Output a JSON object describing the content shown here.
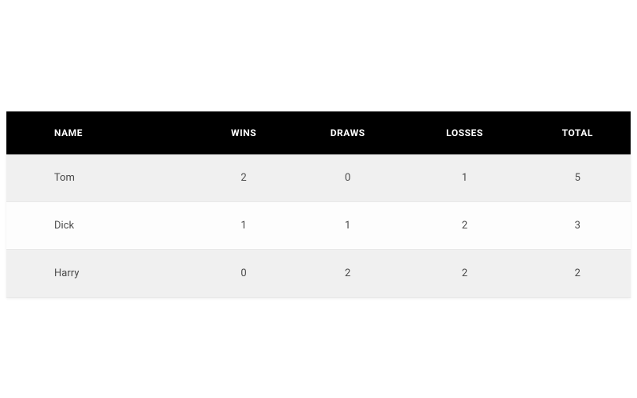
{
  "table": {
    "headers": {
      "name": "NAME",
      "wins": "WINS",
      "draws": "DRAWS",
      "losses": "LOSSES",
      "total": "TOTAL"
    },
    "rows": [
      {
        "name": "Tom",
        "wins": "2",
        "draws": "0",
        "losses": "1",
        "total": "5"
      },
      {
        "name": "Dick",
        "wins": "1",
        "draws": "1",
        "losses": "2",
        "total": "3"
      },
      {
        "name": "Harry",
        "wins": "0",
        "draws": "2",
        "losses": "2",
        "total": "2"
      }
    ]
  },
  "chart_data": {
    "type": "table",
    "columns": [
      "NAME",
      "WINS",
      "DRAWS",
      "LOSSES",
      "TOTAL"
    ],
    "rows": [
      {
        "NAME": "Tom",
        "WINS": 2,
        "DRAWS": 0,
        "LOSSES": 1,
        "TOTAL": 5
      },
      {
        "NAME": "Dick",
        "WINS": 1,
        "DRAWS": 1,
        "LOSSES": 2,
        "TOTAL": 3
      },
      {
        "NAME": "Harry",
        "WINS": 0,
        "DRAWS": 2,
        "LOSSES": 2,
        "TOTAL": 2
      }
    ],
    "title": ""
  }
}
